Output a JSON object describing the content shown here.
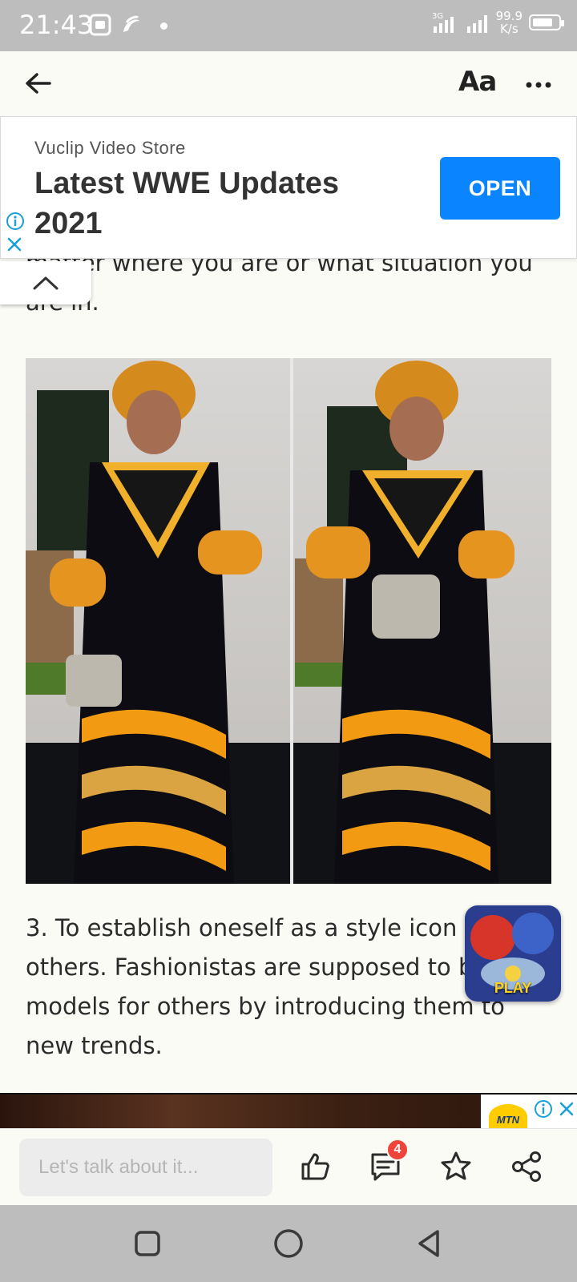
{
  "status_bar": {
    "time": "21:43",
    "net_speed_value": "99.9",
    "net_speed_unit": "K/s",
    "signal_label": "3G"
  },
  "top_bar": {
    "font_button_label": "Aa"
  },
  "banner_ad": {
    "source": "Vuclip Video Store",
    "headline": "Latest WWE Updates 2021",
    "cta_label": "OPEN"
  },
  "article": {
    "partial_line": "matter where you are or what situation you are in.",
    "paragraph_3": "3. To establish oneself as a style icon for others. Fashionistas are supposed to be models for others by introducing them to new trends."
  },
  "game_ad": {
    "label": "PLAY"
  },
  "bottom_ad": {
    "brand": "MTN"
  },
  "comment_bar": {
    "placeholder": "Let's talk about it...",
    "comment_count": "4"
  },
  "colors": {
    "accent": "#0a84ff",
    "badge": "#f0433a",
    "system_bars": "#bdbdbd",
    "page_bg": "#fbfbf6"
  },
  "icons": [
    "back-arrow-icon",
    "more-icon",
    "info-icon",
    "close-icon",
    "chevron-up-icon",
    "like-icon",
    "comment-icon",
    "star-icon",
    "share-icon",
    "recents-icon",
    "home-icon",
    "back-icon"
  ]
}
